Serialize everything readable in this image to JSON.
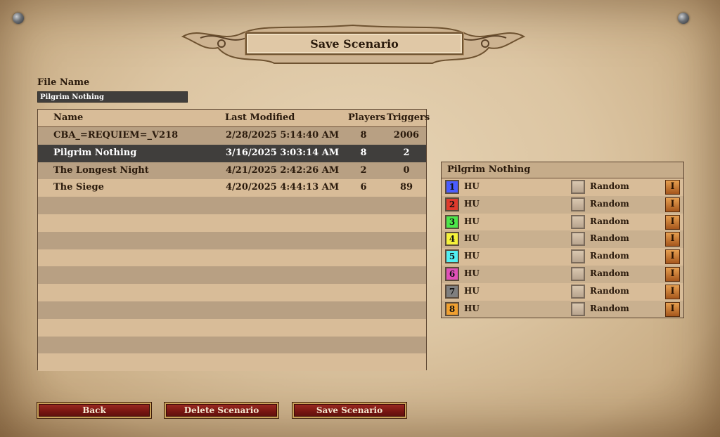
{
  "title": "Save Scenario",
  "file_name": {
    "label": "File Name",
    "value": "Pilgrim Nothing"
  },
  "list": {
    "headers": {
      "name": "Name",
      "modified": "Last Modified",
      "players": "Players",
      "triggers": "Triggers"
    },
    "rows": [
      {
        "name": "CBA_=REQUIEM=_V218",
        "modified": "2/28/2025  5:14:40 AM",
        "players": "8",
        "triggers": "2006"
      },
      {
        "name": "Pilgrim Nothing",
        "modified": "3/16/2025  3:03:14 AM",
        "players": "8",
        "triggers": "2"
      },
      {
        "name": "The Longest Night",
        "modified": "4/21/2025  2:42:26 AM",
        "players": "2",
        "triggers": "0"
      },
      {
        "name": "The Siege",
        "modified": "4/20/2025  4:44:13 AM",
        "players": "6",
        "triggers": "89"
      }
    ],
    "selected_index": 1
  },
  "players_panel": {
    "title": "Pilgrim Nothing",
    "players": [
      {
        "num": "1",
        "color": "#4a5cff",
        "civ": "HU",
        "team": "Random",
        "tool": "I"
      },
      {
        "num": "2",
        "color": "#e03a2c",
        "civ": "HU",
        "team": "Random",
        "tool": "I"
      },
      {
        "num": "3",
        "color": "#4ce64a",
        "civ": "HU",
        "team": "Random",
        "tool": "I"
      },
      {
        "num": "4",
        "color": "#f5f23a",
        "civ": "HU",
        "team": "Random",
        "tool": "I"
      },
      {
        "num": "5",
        "color": "#52eef2",
        "civ": "HU",
        "team": "Random",
        "tool": "I"
      },
      {
        "num": "6",
        "color": "#e050b8",
        "civ": "HU",
        "team": "Random",
        "tool": "I"
      },
      {
        "num": "7",
        "color": "#7f7f7f",
        "civ": "HU",
        "team": "Random",
        "tool": "I"
      },
      {
        "num": "8",
        "color": "#f0a030",
        "civ": "HU",
        "team": "Random",
        "tool": "I"
      }
    ]
  },
  "buttons": {
    "back": "Back",
    "delete": "Delete Scenario",
    "save": "Save Scenario"
  }
}
